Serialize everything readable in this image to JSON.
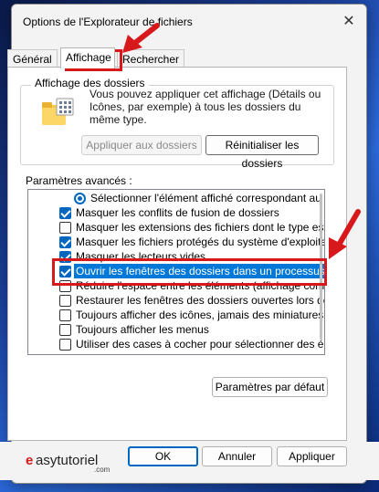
{
  "window": {
    "title": "Options de l'Explorateur de fichiers"
  },
  "tabs": [
    {
      "label": "Général"
    },
    {
      "label": "Affichage"
    },
    {
      "label": "Rechercher"
    }
  ],
  "folder_views": {
    "title": "Affichage des dossiers",
    "description": "Vous pouvez appliquer cet affichage (Détails ou Icônes, par exemple) à tous les dossiers du même type.",
    "apply_label": "Appliquer aux dossiers",
    "reset_label": "Réinitialiser les dossiers"
  },
  "advanced": {
    "title": "Paramètres avancés :",
    "items": [
      {
        "label": "Sélectionner l'élément affiché correspondant au texte",
        "type": "radio",
        "checked": true
      },
      {
        "label": "Masquer les conflits de fusion de dossiers",
        "type": "checkbox",
        "checked": true
      },
      {
        "label": "Masquer les extensions des fichiers dont le type est connu",
        "type": "checkbox",
        "checked": false
      },
      {
        "label": "Masquer les fichiers protégés du système d'exploitation (re",
        "type": "checkbox",
        "checked": true
      },
      {
        "label": "Masquer les lecteurs vides",
        "type": "checkbox",
        "checked": true
      },
      {
        "label": "Ouvrir les fenêtres des dossiers dans un processus différe",
        "type": "checkbox",
        "checked": true
      },
      {
        "label": "Réduire l'espace entre les éléments (affichage compact)",
        "type": "checkbox",
        "checked": false
      },
      {
        "label": "Restaurer les fenêtres des dossiers ouvertes lors de la proc",
        "type": "checkbox",
        "checked": false
      },
      {
        "label": "Toujours afficher des icônes, jamais des miniatures",
        "type": "checkbox",
        "checked": false
      },
      {
        "label": "Toujours afficher les menus",
        "type": "checkbox",
        "checked": false
      },
      {
        "label": "Utiliser des cases à cocher pour sélectionner des élément",
        "type": "checkbox",
        "checked": false
      }
    ],
    "defaults_label": "Paramètres par défaut"
  },
  "footer": {
    "ok_label": "OK",
    "cancel_label": "Annuler",
    "apply_label": "Appliquer",
    "logo_text": "easytutoriel",
    "logo_sub": ".com"
  },
  "colors": {
    "accent": "#0067c0",
    "selection": "#0078d7",
    "annotation": "#d7191c"
  }
}
